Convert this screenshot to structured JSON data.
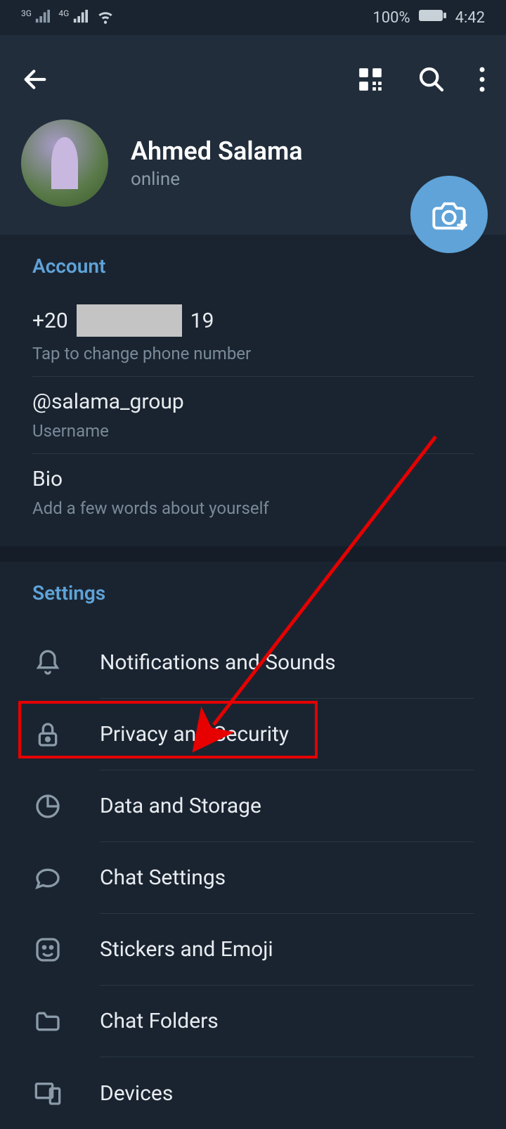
{
  "status": {
    "network1": "3G",
    "network2": "4G",
    "battery": "100%",
    "time": "4:42"
  },
  "profile": {
    "name": "Ahmed Salama",
    "status": "online"
  },
  "account": {
    "header": "Account",
    "phone_prefix": "+20",
    "phone_suffix": "19",
    "phone_label": "Tap to change phone number",
    "username": "@salama_group",
    "username_label": "Username",
    "bio_title": "Bio",
    "bio_label": "Add a few words about yourself"
  },
  "settings": {
    "header": "Settings",
    "items": [
      {
        "label": "Notifications and Sounds"
      },
      {
        "label": "Privacy and Security"
      },
      {
        "label": "Data and Storage"
      },
      {
        "label": "Chat Settings"
      },
      {
        "label": "Stickers and Emoji"
      },
      {
        "label": "Chat Folders"
      },
      {
        "label": "Devices"
      }
    ]
  }
}
